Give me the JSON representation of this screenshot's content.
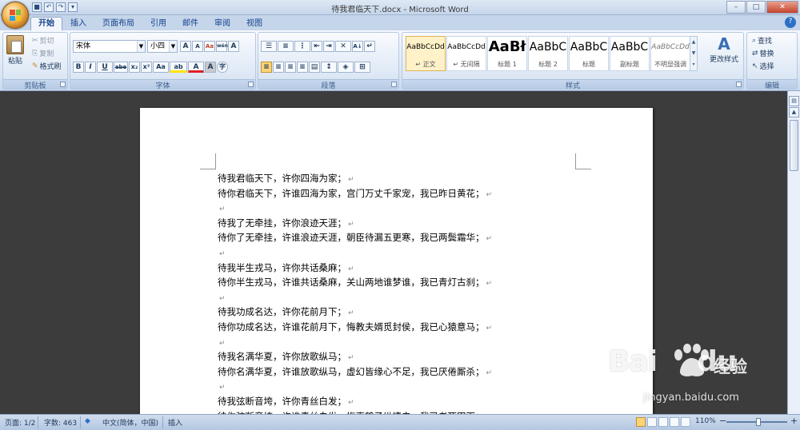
{
  "window": {
    "title": "待我君临天下.docx - Microsoft Word",
    "minimize": "–",
    "maximize": "□",
    "close": "✕"
  },
  "quick_access": [
    "save-icon",
    "undo-icon",
    "redo-icon",
    "open-icon"
  ],
  "tabs": [
    {
      "label": "开始",
      "active": true
    },
    {
      "label": "插入"
    },
    {
      "label": "页面布局"
    },
    {
      "label": "引用"
    },
    {
      "label": "邮件"
    },
    {
      "label": "审阅"
    },
    {
      "label": "视图"
    }
  ],
  "help_label": "?",
  "ribbon": {
    "clipboard": {
      "title": "剪贴板",
      "paste": "粘贴",
      "cut": "剪切",
      "copy": "复制",
      "format_painter": "格式刷"
    },
    "font": {
      "title": "字体",
      "font_name": "宋体",
      "font_size": "小四",
      "grow": "A",
      "shrink": "A",
      "clear": "Aa",
      "phonetic": "wén",
      "border": "A",
      "bold": "B",
      "italic": "I",
      "underline": "U",
      "strike": "abe",
      "subscript": "x₂",
      "superscript": "x²",
      "case": "Aa",
      "highlight": "ab",
      "font_color": "A",
      "shading": "A",
      "enclose": "字"
    },
    "paragraph": {
      "title": "段落",
      "sort": "A↓",
      "show_marks": "↵"
    },
    "styles": {
      "title": "样式",
      "items": [
        {
          "sample": "AaBbCcDd",
          "name": "↵ 正文",
          "active": true
        },
        {
          "sample": "AaBbCcDd",
          "name": "↵ 无间隔"
        },
        {
          "sample": "AaBł",
          "name": "标题 1"
        },
        {
          "sample": "AaBbC",
          "name": "标题 2"
        },
        {
          "sample": "AaBbC",
          "name": "标题"
        },
        {
          "sample": "AaBbC",
          "name": "副标题"
        },
        {
          "sample": "AaBbCcDd",
          "name": "不明显强调"
        }
      ],
      "change_styles": "更改样式"
    },
    "editing": {
      "title": "编辑",
      "find": "查找",
      "replace": "替换",
      "select": "选择"
    }
  },
  "document": {
    "lines": [
      "待我君临天下，许你四海为家；",
      "待你君临天下，许谁四海为家，宫门万丈千家宠，我已昨日黄花；",
      "",
      "待我了无牵挂，许你浪迹天涯；",
      "待你了无牵挂，许谁浪迹天涯，朝臣待漏五更寒，我已两鬓霜华；",
      "",
      "待我半生戎马，许你共话桑麻；",
      "待你半生戎马，许谁共话桑麻，关山两地谁梦谁，我已青灯古刹；",
      "",
      "待我功成名达，许你花前月下；",
      "待你功成名达，许谁花前月下，悔教夫婿觅封侯，我已心猿意马；",
      "",
      "待我名满华夏，许你放歌纵马；",
      "待你名满华夏，许谁放歌纵马，虚幻皆缘心不足，我已厌倦厮杀；",
      "",
      "待我弦断音垮，许你青丝白发；",
      "待你弦断音垮，许谁青丝白发，梅妻鹤子纵情去，我已老死田下；"
    ],
    "paragraph_mark": "↵"
  },
  "status": {
    "page": "页面: 1/2",
    "words": "字数: 463",
    "language": "中文(简体，中国)",
    "mode": "插入",
    "zoom": "110%",
    "zoom_out": "−",
    "zoom_in": "+"
  },
  "watermark": {
    "brand": "Bai",
    "brand2": "du",
    "cn": "经验",
    "url": "jingyan.baidu.com"
  },
  "colors": {
    "accent": "#2b579a",
    "ribbon": "#dbe6f4",
    "workspace": "#3c3c3c"
  }
}
